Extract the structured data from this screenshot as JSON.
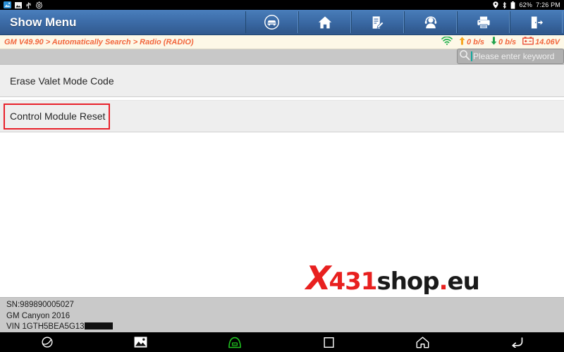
{
  "status_bar": {
    "left_icons": [
      "download-image-icon",
      "gallery-icon",
      "usb-icon",
      "settings-icon"
    ],
    "location_icon": "location-pin-icon",
    "bluetooth_icon": "bluetooth-icon",
    "battery_icon": "battery-icon",
    "battery_percent": "62%",
    "clock": "7:26 PM"
  },
  "header": {
    "title": "Show Menu",
    "toolbar": [
      {
        "name": "vehicle-button",
        "icon": "car-circle-icon"
      },
      {
        "name": "home-button",
        "icon": "home-icon"
      },
      {
        "name": "report-button",
        "icon": "edit-document-icon"
      },
      {
        "name": "support-button",
        "icon": "headset-person-icon"
      },
      {
        "name": "print-button",
        "icon": "printer-icon"
      },
      {
        "name": "exit-button",
        "icon": "exit-door-icon"
      }
    ]
  },
  "breadcrumb": {
    "text": "GM V49.90 > Automatically Search > Radio (RADIO)"
  },
  "network": {
    "wifi_icon": "wifi-icon",
    "upload_icon": "upload-arrow-icon",
    "upload_rate": "0 b/s",
    "download_icon": "download-arrow-icon",
    "download_rate": "0 b/s",
    "battery_icon": "car-battery-icon",
    "voltage": "14.06V"
  },
  "search": {
    "icon": "search-icon",
    "placeholder": "Please enter keyword",
    "value": ""
  },
  "menu": {
    "items": [
      {
        "label": "Erase Valet Mode Code",
        "selected": false
      },
      {
        "label": "Control Module Reset",
        "selected": true
      }
    ]
  },
  "watermark": {
    "x": "X",
    "num": "431",
    "shop": "shop",
    "dot": ".",
    "eu": "eu"
  },
  "vehicle_info": {
    "serial": "SN:989890005027",
    "model": "GM Canyon 2016",
    "vin_label": "VIN 1GTH5BEA5G13",
    "vin_redacted": true
  },
  "nav_bar": {
    "items": [
      {
        "name": "browser-button",
        "icon": "globe-icon"
      },
      {
        "name": "gallery-button",
        "icon": "picture-icon"
      },
      {
        "name": "vci-button",
        "icon": "vci-connector-icon"
      },
      {
        "name": "recents-button",
        "icon": "square-icon"
      },
      {
        "name": "home-button",
        "icon": "home-outline-icon"
      },
      {
        "name": "back-button",
        "icon": "back-arrow-icon"
      }
    ]
  },
  "colors": {
    "header_blue": "#3d6da9",
    "breadcrumb_orange": "#f2663c",
    "selection_red": "#e8202a",
    "vci_green": "#21c421",
    "watermark_red": "#e8201f"
  }
}
